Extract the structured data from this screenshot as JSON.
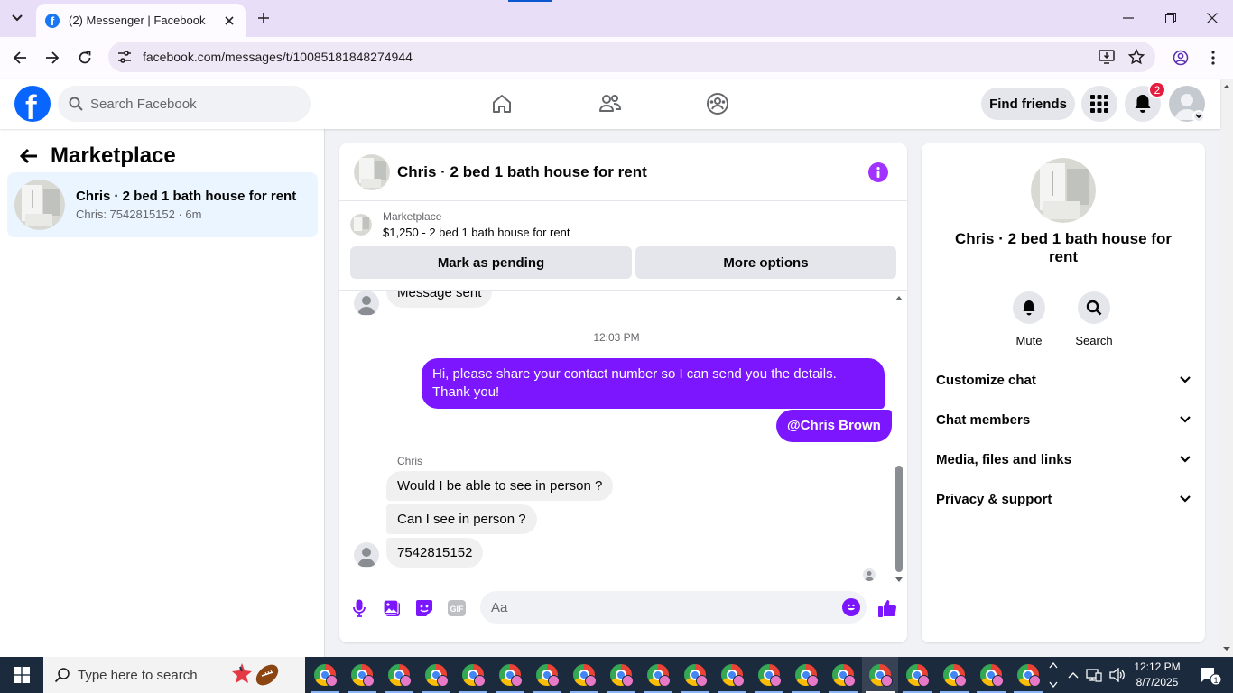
{
  "browser": {
    "tab_title": "(2) Messenger | Facebook",
    "url": "facebook.com/messages/t/10085181848274944"
  },
  "header": {
    "logo_letter": "f",
    "search_placeholder": "Search Facebook",
    "find_friends": "Find friends",
    "notification_count": "2"
  },
  "sidebar": {
    "title": "Marketplace",
    "conversations": [
      {
        "name": "Chris · 2 bed 1 bath house for rent",
        "preview": "Chris: 7542815152 · 6m"
      }
    ]
  },
  "chat": {
    "title": "Chris · 2 bed 1 bath house for rent",
    "marketplace_label": "Marketplace",
    "listing": "$1,250 - 2 bed 1 bath house for rent",
    "mark_pending": "Mark as pending",
    "more_options": "More options",
    "messages": {
      "message_sent": "Message sent",
      "timestamp": "12:03 PM",
      "outgoing_1": "Hi, please share your contact number so I can send you the details. Thank you!",
      "outgoing_2": "@Chris Brown",
      "sender_name": "Chris",
      "incoming_1": "Would I be able to see in person ?",
      "incoming_2": "Can I see in person ?",
      "incoming_3": "7542815152"
    },
    "composer_placeholder": "Aa",
    "gif_label": "GIF",
    "accent_color": "#7b16ff"
  },
  "details": {
    "name": "Chris · 2 bed 1 bath house for rent",
    "mute": "Mute",
    "search": "Search",
    "sections": [
      "Customize chat",
      "Chat members",
      "Media, files and links",
      "Privacy & support"
    ]
  },
  "taskbar": {
    "search_placeholder": "Type here to search",
    "time": "12:12 PM",
    "date": "8/7/2025",
    "notification_count": "1"
  }
}
